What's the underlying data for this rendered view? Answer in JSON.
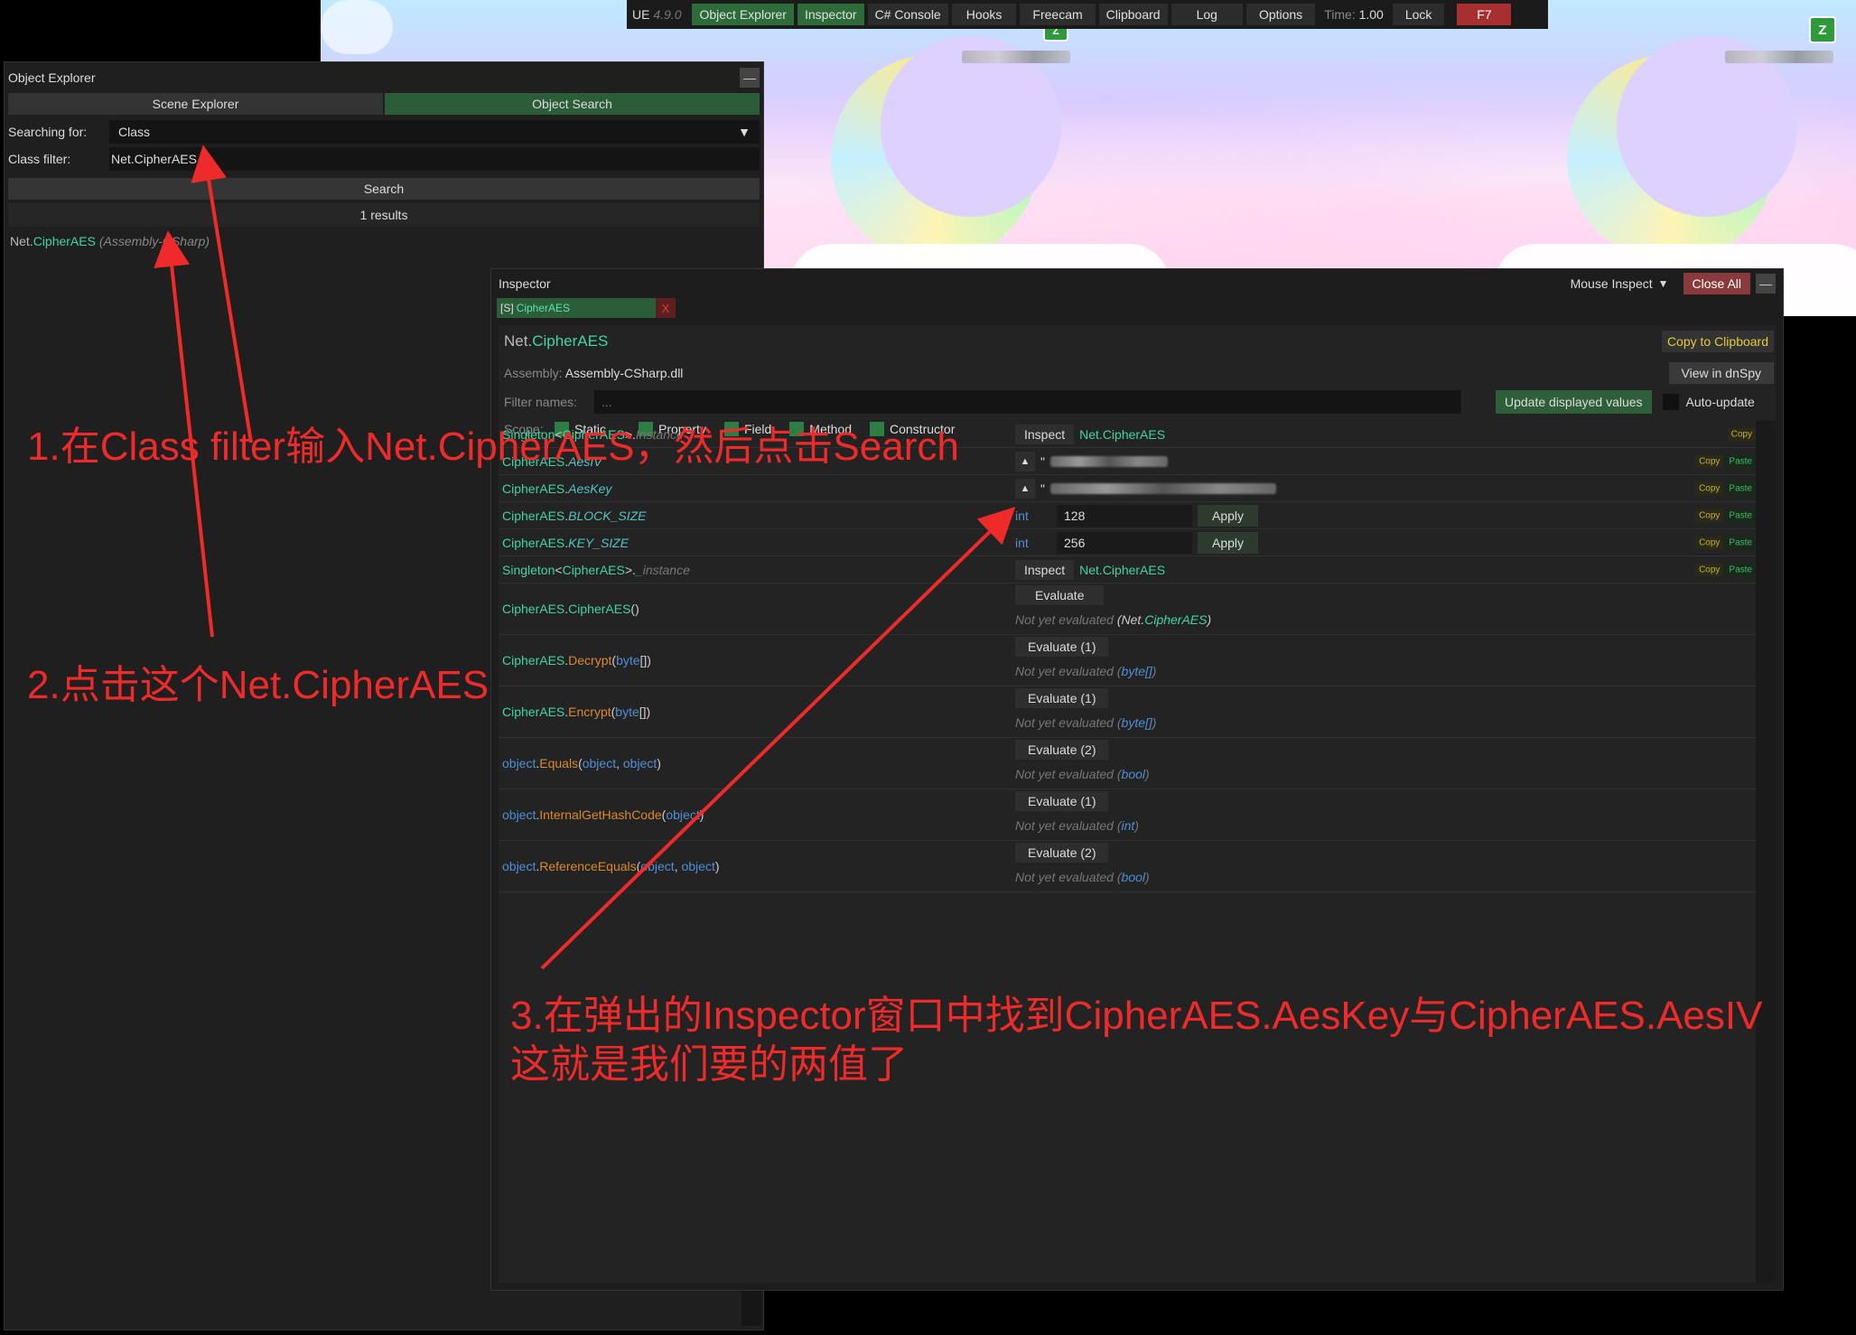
{
  "topbar": {
    "product": "UE",
    "version": "4.9.0",
    "buttons": [
      {
        "label": "Object Explorer",
        "active": true
      },
      {
        "label": "Inspector",
        "active": true
      },
      {
        "label": "C# Console",
        "active": false
      },
      {
        "label": "Hooks",
        "active": false
      },
      {
        "label": "Freecam",
        "active": false
      },
      {
        "label": "Clipboard",
        "active": false
      },
      {
        "label": "Log",
        "active": false
      },
      {
        "label": "Options",
        "active": false
      }
    ],
    "time_label": "Time:",
    "time_value": "1.00",
    "lock": "Lock",
    "hotkey": "F7"
  },
  "game": {
    "badge": "Z"
  },
  "object_explorer": {
    "title": "Object Explorer",
    "minimize": "—",
    "tabs": [
      "Scene Explorer",
      "Object Search"
    ],
    "searching_for_label": "Searching for:",
    "searching_for_value": "Class",
    "class_filter_label": "Class filter:",
    "class_filter_value": "Net.CipherAES",
    "search_button": "Search",
    "results_text": "1 results",
    "result": {
      "ns": "Net.",
      "cls": "CipherAES",
      "asm": "(Assembly-CSharp)"
    }
  },
  "inspector": {
    "title": "Inspector",
    "mouse_inspect": "Mouse Inspect",
    "close_all": "Close All",
    "minimize": "—",
    "tab": {
      "prefix": "[S]",
      "cls": "CipherAES",
      "close": "X"
    },
    "type_ns": "Net.",
    "type_cls": "CipherAES",
    "copy_to_clipboard": "Copy to Clipboard",
    "view_in_dnspy": "View in dnSpy",
    "assembly_label": "Assembly:",
    "assembly_value": "Assembly-CSharp.dll",
    "filter_label": "Filter names:",
    "filter_placeholder": "...",
    "update_values": "Update displayed values",
    "auto_update": "Auto-update",
    "scope_label": "Scope:",
    "scopes": [
      "Static",
      "Property",
      "Field",
      "Method",
      "Constructor"
    ],
    "copy": "Copy",
    "paste": "Paste",
    "members": {
      "instance": {
        "a": "Singleton",
        "b": "<",
        "c": "CipherAES",
        "d": ">.",
        "e": "Instance",
        "btn": "Inspect",
        "val": "Net.CipherAES"
      },
      "aesiv": {
        "cls": "CipherAES",
        "sep": ".",
        "name": "AesIV",
        "quote": "\""
      },
      "aeskey": {
        "cls": "CipherAES",
        "sep": ".",
        "name": "AesKey",
        "quote": "\""
      },
      "block": {
        "cls": "CipherAES",
        "sep": ".",
        "name": "BLOCK_SIZE",
        "type": "int",
        "value": "128",
        "apply": "Apply"
      },
      "key": {
        "cls": "CipherAES",
        "sep": ".",
        "name": "KEY_SIZE",
        "type": "int",
        "value": "256",
        "apply": "Apply"
      },
      "_instance": {
        "a": "Singleton",
        "b": "<",
        "c": "CipherAES",
        "d": ">.",
        "e": "_instance",
        "btn": "Inspect",
        "val": "Net.CipherAES"
      },
      "ctor": {
        "cls": "CipherAES",
        "sep": ".",
        "name": "CipherAES",
        "args": "()",
        "btn": "Evaluate",
        "ne": "Not yet evaluated",
        "ret_l": "(",
        "ret_ns": "Net.",
        "ret_cls": "CipherAES",
        "ret_r": ")"
      },
      "decrypt": {
        "cls": "CipherAES",
        "sep": ".",
        "name": "Decrypt",
        "lp": "(",
        "arg": "byte",
        "rp": "[])",
        "btn": "Evaluate (1)",
        "ne": "Not yet evaluated",
        "ret": "byte[]"
      },
      "encrypt": {
        "cls": "CipherAES",
        "sep": ".",
        "name": "Encrypt",
        "lp": "(",
        "arg": "byte",
        "rp": "[])",
        "btn": "Evaluate (1)",
        "ne": "Not yet evaluated",
        "ret": "byte[]"
      },
      "equals": {
        "obj": "object",
        "sep": ".",
        "name": "Equals",
        "lp": "(",
        "arg1": "object",
        "comma": ", ",
        "arg2": "object",
        "rp": ")",
        "btn": "Evaluate (2)",
        "ne": "Not yet evaluated",
        "ret": "bool"
      },
      "hash": {
        "obj": "object",
        "sep": ".",
        "name": "InternalGetHashCode",
        "lp": "(",
        "arg1": "object",
        "rp": ")",
        "btn": "Evaluate (1)",
        "ne": "Not yet evaluated",
        "ret": "int"
      },
      "refeq": {
        "obj": "object",
        "sep": ".",
        "name": "ReferenceEquals",
        "lp": "(",
        "arg1": "object",
        "comma": ", ",
        "arg2": "object",
        "rp": ")",
        "btn": "Evaluate (2)",
        "ne": "Not yet evaluated",
        "ret": "bool"
      }
    }
  },
  "annotations": {
    "step1": "1.在Class filter输入Net.CipherAES，然后点击Search",
    "step2": "2.点击这个Net.CipherAES",
    "step3_line1": "3.在弹出的Inspector窗口中找到CipherAES.AesKey与CipherAES.AesIV",
    "step3_line2": "这就是我们要的两值了",
    "color": "#ef2a2a"
  }
}
